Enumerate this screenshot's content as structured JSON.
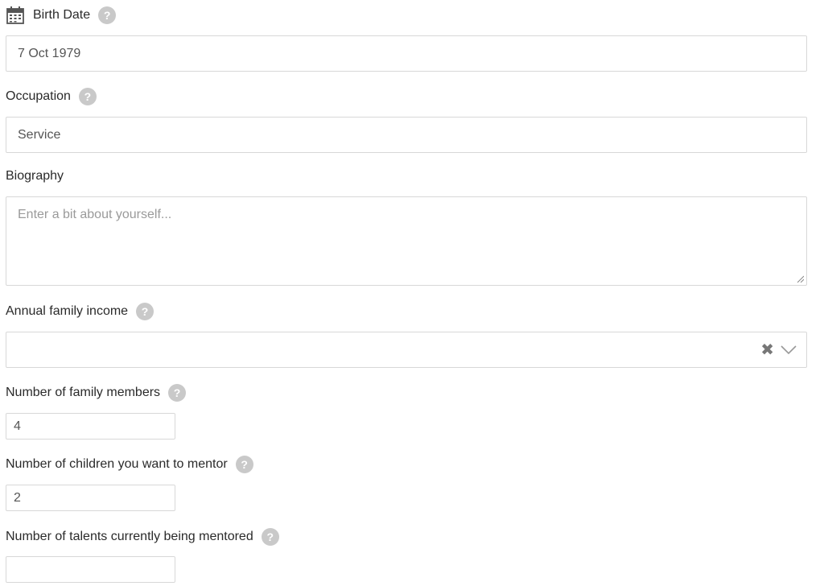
{
  "birth_date": {
    "label": "Birth Date",
    "value": "7 Oct 1979"
  },
  "occupation": {
    "label": "Occupation",
    "value": "Service"
  },
  "biography": {
    "label": "Biography",
    "placeholder": "Enter a bit about yourself..."
  },
  "income": {
    "label": "Annual family income",
    "value": ""
  },
  "family_members": {
    "label": "Number of family members",
    "value": "4"
  },
  "children_mentor": {
    "label": "Number of children you want to mentor",
    "value": "2"
  },
  "talents_mentored": {
    "label": "Number of talents currently being mentored",
    "value": ""
  },
  "icons": {
    "calendar": "calendar-icon",
    "help": "question-icon",
    "clear": "clear-x-icon",
    "dropdown": "chevron-down-icon"
  },
  "colors": {
    "border": "#d8d8d8",
    "help_bg": "#c9c9c9",
    "text": "#2a2a2a",
    "placeholder": "#9a9a9a"
  }
}
